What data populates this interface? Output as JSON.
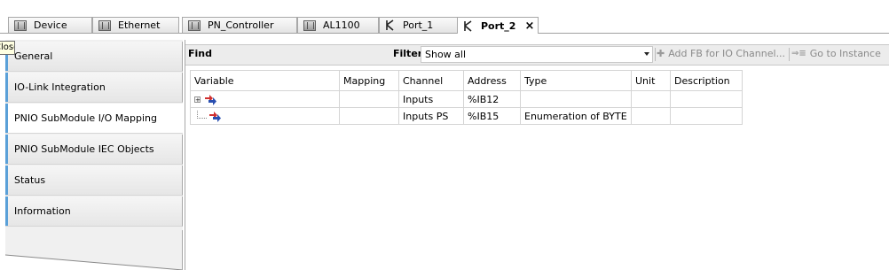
{
  "tabs": [
    {
      "label": "Device",
      "icon": "device-icon"
    },
    {
      "label": "Ethernet",
      "icon": "device-icon"
    },
    {
      "label": "PN_Controller",
      "icon": "device-icon"
    },
    {
      "label": "AL1100",
      "icon": "device-icon"
    },
    {
      "label": "Port_1",
      "icon": "port-icon"
    },
    {
      "label": "Port_2",
      "icon": "port-icon",
      "active": true,
      "close": "×"
    }
  ],
  "tooltip": {
    "text": "Close"
  },
  "nav": {
    "items": [
      {
        "label": "General"
      },
      {
        "label": "IO-Link Integration"
      },
      {
        "label": "PNIO SubModule I/O Mapping",
        "selected": true
      },
      {
        "label": "PNIO SubModule IEC Objects"
      },
      {
        "label": "Status"
      },
      {
        "label": "Information"
      }
    ]
  },
  "toolbar": {
    "find_label": "Find",
    "find_value": "",
    "filter_label": "Filter",
    "filter_value": "Show all",
    "add_fb_label": "Add FB for IO Channel...",
    "goto_label": "Go to Instance"
  },
  "table": {
    "columns": [
      "Variable",
      "Mapping",
      "Channel",
      "Address",
      "Type",
      "Unit",
      "Description"
    ],
    "rows": [
      {
        "variable": "",
        "mapping": "",
        "channel": "Inputs",
        "address": "%IB12",
        "type": "",
        "unit": "",
        "description": ""
      },
      {
        "variable": "",
        "mapping": "",
        "channel": "Inputs PS",
        "address": "%IB15",
        "type": "Enumeration of BYTE",
        "unit": "",
        "description": ""
      }
    ]
  },
  "colors": {
    "accent": "#5aa0d8",
    "tooltip_bg": "#ffffe1",
    "disabled_text": "#8a8a8a"
  }
}
